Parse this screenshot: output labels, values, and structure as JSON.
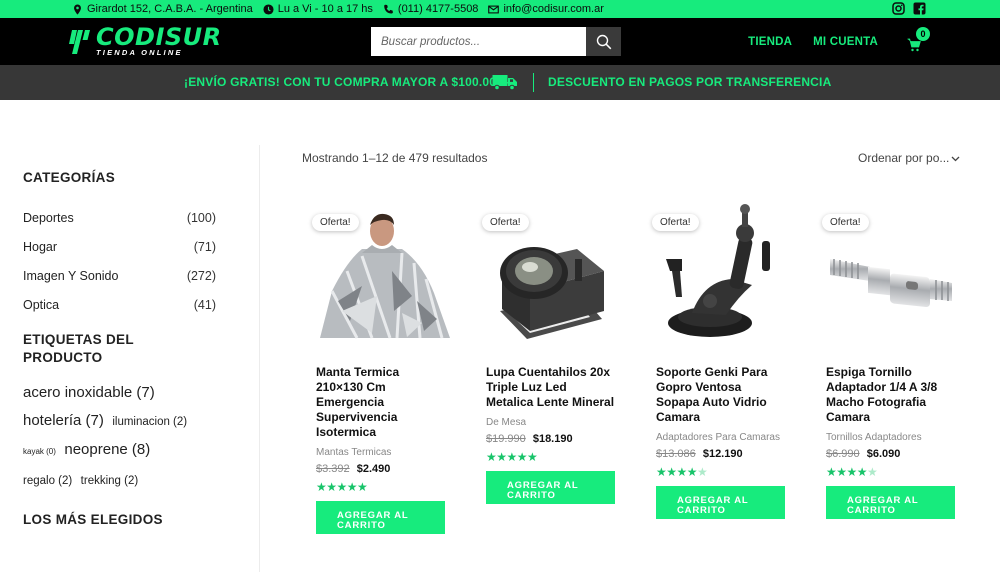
{
  "topbar": {
    "address": "Girardot 152, C.A.B.A. - Argentina",
    "hours": "Lu a Vi - 10 a 17 hs",
    "phone": "(011) 4177-5508",
    "email": "info@codisur.com.ar",
    "social": [
      "instagram-icon",
      "facebook-icon"
    ]
  },
  "header": {
    "logo_name": "CODISUR",
    "logo_sub": "TIENDA ONLINE",
    "search_placeholder": "Buscar productos...",
    "nav": [
      "TIENDA",
      "MI CUENTA"
    ],
    "cart_count": "0"
  },
  "promo": {
    "left": "¡ENVÍO GRATIS! CON TU COMPRA MAYOR A $100.000.-",
    "right": "DESCUENTO EN PAGOS POR TRANSFERENCIA"
  },
  "sidebar": {
    "categories_title": "CATEGORÍAS",
    "categories": [
      {
        "name": "Deportes",
        "count": "(100)"
      },
      {
        "name": "Hogar",
        "count": "(71)"
      },
      {
        "name": "Imagen Y Sonido",
        "count": "(272)"
      },
      {
        "name": "Optica",
        "count": "(41)"
      }
    ],
    "tags_title": "ETIQUETAS DEL PRODUCTO",
    "tags": [
      {
        "label": "acero inoxidable (7)"
      },
      {
        "label": "hotelería (7)"
      },
      {
        "label": "iluminacion (2)"
      },
      {
        "label": "kayak (0)"
      },
      {
        "label": "neoprene (8)"
      },
      {
        "label": "regalo (2)"
      },
      {
        "label": "trekking (2)"
      }
    ],
    "popular_title": "LOS MÁS ELEGIDOS"
  },
  "main": {
    "result_count": "Mostrando 1–12 de 479 resultados",
    "ordering": "Ordenar por po..."
  },
  "products": [
    {
      "badge": "Oferta!",
      "title": "Manta Termica 210×130 Cm Emergencia Supervivencia Isotermica",
      "category": "Mantas Termicas",
      "old_price": "$3.392",
      "new_price": "$2.490",
      "rating": 5,
      "button": "AGREGAR AL CARRITO"
    },
    {
      "badge": "Oferta!",
      "title": "Lupa Cuentahilos 20x Triple Luz Led Metalica Lente Mineral",
      "category": "De Mesa",
      "old_price": "$19.990",
      "new_price": "$18.190",
      "rating": 5,
      "button": "AGREGAR AL CARRITO"
    },
    {
      "badge": "Oferta!",
      "title": "Soporte Genki Para Gopro Ventosa Sopapa Auto Vidrio Camara",
      "category": "Adaptadores Para Camaras",
      "old_price": "$13.086",
      "new_price": "$12.190",
      "rating": 4,
      "button": "AGREGAR AL CARRITO"
    },
    {
      "badge": "Oferta!",
      "title": "Espiga Tornillo Adaptador 1/4 A 3/8 Macho Fotografia Camara",
      "category": "Tornillos Adaptadores",
      "old_price": "$6.990",
      "new_price": "$6.090",
      "rating": 4.5,
      "button": "AGREGAR AL CARRITO"
    }
  ],
  "colors": {
    "accent": "#17eb7d",
    "header_bg": "#000000",
    "promo_bg": "#373737"
  }
}
